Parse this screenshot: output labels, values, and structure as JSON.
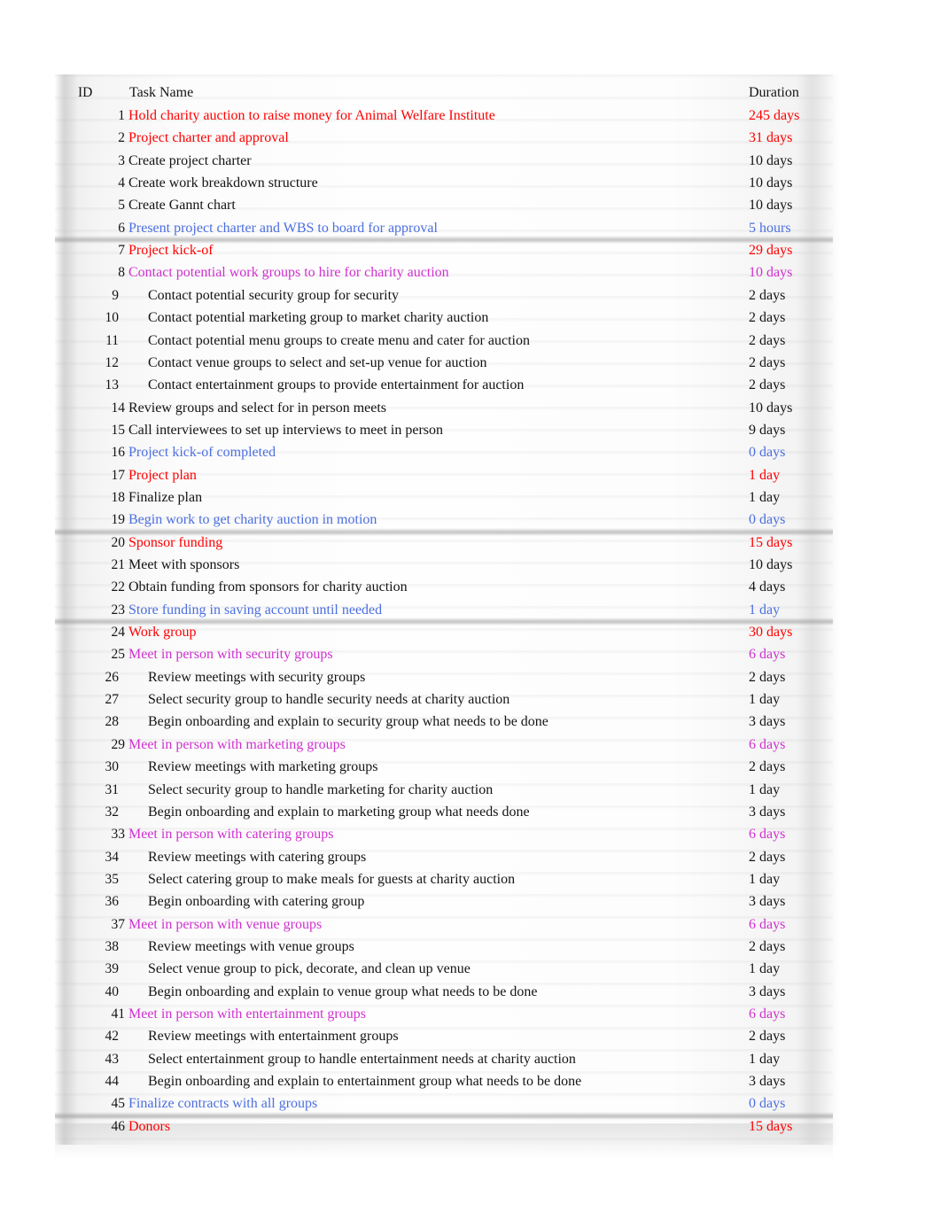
{
  "header": {
    "id_label": "ID",
    "name_label": "Task Name",
    "duration_label": "Duration"
  },
  "colors": {
    "summary": "#FF0000",
    "milestone": "#4C6FE0",
    "sub_summary": "#D030D0",
    "normal": "#141414"
  },
  "rows": [
    {
      "id": "1",
      "name": "Hold charity auction to raise money for Animal Welfare Institute",
      "duration": "245 days",
      "kind": "red",
      "indent": 0
    },
    {
      "id": "2",
      "name": "Project charter and approval",
      "duration": "31 days",
      "kind": "red",
      "indent": 0
    },
    {
      "id": "3",
      "name": "Create project charter",
      "duration": "10 days",
      "kind": "black",
      "indent": 0
    },
    {
      "id": "4",
      "name": "Create work breakdown structure",
      "duration": "10 days",
      "kind": "black",
      "indent": 0
    },
    {
      "id": "5",
      "name": "Create Gannt chart",
      "duration": "10 days",
      "kind": "black",
      "indent": 0
    },
    {
      "id": "6",
      "name": "Present project charter and WBS to board for approval",
      "duration": "5 hours",
      "kind": "blue",
      "indent": 0
    },
    {
      "id": "7",
      "name": "Project kick-of",
      "duration": "29 days",
      "kind": "red",
      "indent": 0
    },
    {
      "id": "8",
      "name": "Contact potential work groups to hire for charity auction",
      "duration": "10 days",
      "kind": "magenta",
      "indent": 0
    },
    {
      "id": "9",
      "name": "Contact potential security group for security",
      "duration": "2 days",
      "kind": "black",
      "indent": 1
    },
    {
      "id": "10",
      "name": "Contact potential marketing group to market charity auction",
      "duration": "2 days",
      "kind": "black",
      "indent": 1
    },
    {
      "id": "11",
      "name": "Contact potential menu groups to create menu and cater for auction",
      "duration": "2 days",
      "kind": "black",
      "indent": 1
    },
    {
      "id": "12",
      "name": "Contact venue groups to select and set-up venue for auction",
      "duration": "2 days",
      "kind": "black",
      "indent": 1
    },
    {
      "id": "13",
      "name": "Contact entertainment groups to provide entertainment for auction",
      "duration": "2 days",
      "kind": "black",
      "indent": 1
    },
    {
      "id": "14",
      "name": "Review groups and select for in person meets",
      "duration": "10 days",
      "kind": "black",
      "indent": 0
    },
    {
      "id": "15",
      "name": "Call interviewees to set up interviews to meet in person",
      "duration": "9 days",
      "kind": "black",
      "indent": 0
    },
    {
      "id": "16",
      "name": "Project kick-of completed",
      "duration": "0 days",
      "kind": "blue",
      "indent": 0
    },
    {
      "id": "17",
      "name": "Project plan",
      "duration": "1 day",
      "kind": "red",
      "indent": 0
    },
    {
      "id": "18",
      "name": "Finalize plan",
      "duration": "1 day",
      "kind": "black",
      "indent": 0
    },
    {
      "id": "19",
      "name": "Begin work to get charity auction in motion",
      "duration": "0 days",
      "kind": "blue",
      "indent": 0
    },
    {
      "id": "20",
      "name": "Sponsor funding",
      "duration": "15 days",
      "kind": "red",
      "indent": 0
    },
    {
      "id": "21",
      "name": "Meet with sponsors",
      "duration": "10 days",
      "kind": "black",
      "indent": 0
    },
    {
      "id": "22",
      "name": "Obtain funding from sponsors for charity auction",
      "duration": "4 days",
      "kind": "black",
      "indent": 0
    },
    {
      "id": "23",
      "name": "Store funding in saving account until needed",
      "duration": "1 day",
      "kind": "blue",
      "indent": 0
    },
    {
      "id": "24",
      "name": "Work group",
      "duration": "30 days",
      "kind": "red",
      "indent": 0
    },
    {
      "id": "25",
      "name": "Meet in person with security groups",
      "duration": "6 days",
      "kind": "magenta",
      "indent": 0
    },
    {
      "id": "26",
      "name": "Review meetings with security groups",
      "duration": "2 days",
      "kind": "black",
      "indent": 1
    },
    {
      "id": "27",
      "name": "Select security group to handle security needs at charity auction",
      "duration": "1 day",
      "kind": "black",
      "indent": 1
    },
    {
      "id": "28",
      "name": "Begin onboarding and explain to security group what needs to be done",
      "duration": "3 days",
      "kind": "black",
      "indent": 1
    },
    {
      "id": "29",
      "name": "Meet in person with marketing groups",
      "duration": "6 days",
      "kind": "magenta",
      "indent": 0
    },
    {
      "id": "30",
      "name": "Review meetings with marketing groups",
      "duration": "2 days",
      "kind": "black",
      "indent": 1
    },
    {
      "id": "31",
      "name": "Select security group to handle marketing for charity auction",
      "duration": "1 day",
      "kind": "black",
      "indent": 1
    },
    {
      "id": "32",
      "name": "Begin onboarding and explain to marketing group what needs done",
      "duration": "3 days",
      "kind": "black",
      "indent": 1
    },
    {
      "id": "33",
      "name": "Meet in person with catering groups",
      "duration": "6 days",
      "kind": "magenta",
      "indent": 0
    },
    {
      "id": "34",
      "name": "Review meetings with catering groups",
      "duration": "2 days",
      "kind": "black",
      "indent": 1
    },
    {
      "id": "35",
      "name": "Select catering group to make meals for guests at charity auction",
      "duration": "1 day",
      "kind": "black",
      "indent": 1
    },
    {
      "id": "36",
      "name": "Begin onboarding with catering group",
      "duration": "3 days",
      "kind": "black",
      "indent": 1
    },
    {
      "id": "37",
      "name": "Meet in person with venue groups",
      "duration": "6 days",
      "kind": "magenta",
      "indent": 0
    },
    {
      "id": "38",
      "name": "Review meetings with venue groups",
      "duration": "2 days",
      "kind": "black",
      "indent": 1
    },
    {
      "id": "39",
      "name": "Select venue group to pick, decorate, and clean up venue",
      "duration": "1 day",
      "kind": "black",
      "indent": 1
    },
    {
      "id": "40",
      "name": "Begin onboarding and explain to venue group what needs to be done",
      "duration": "3 days",
      "kind": "black",
      "indent": 1
    },
    {
      "id": "41",
      "name": "Meet in person with entertainment groups",
      "duration": "6 days",
      "kind": "magenta",
      "indent": 0
    },
    {
      "id": "42",
      "name": "Review meetings with entertainment groups",
      "duration": "2 days",
      "kind": "black",
      "indent": 1
    },
    {
      "id": "43",
      "name": "Select entertainment group to handle entertainment needs at charity auction",
      "duration": "1 day",
      "kind": "black",
      "indent": 1
    },
    {
      "id": "44",
      "name": "Begin onboarding and explain to entertainment group what needs to be done",
      "duration": "3 days",
      "kind": "black",
      "indent": 1
    },
    {
      "id": "45",
      "name": "Finalize contracts with all groups",
      "duration": "0 days",
      "kind": "blue",
      "indent": 0
    },
    {
      "id": "46",
      "name": "Donors",
      "duration": "15 days",
      "kind": "red",
      "indent": 0
    }
  ],
  "divider_after_ids": [
    "6",
    "19",
    "23",
    "45"
  ]
}
